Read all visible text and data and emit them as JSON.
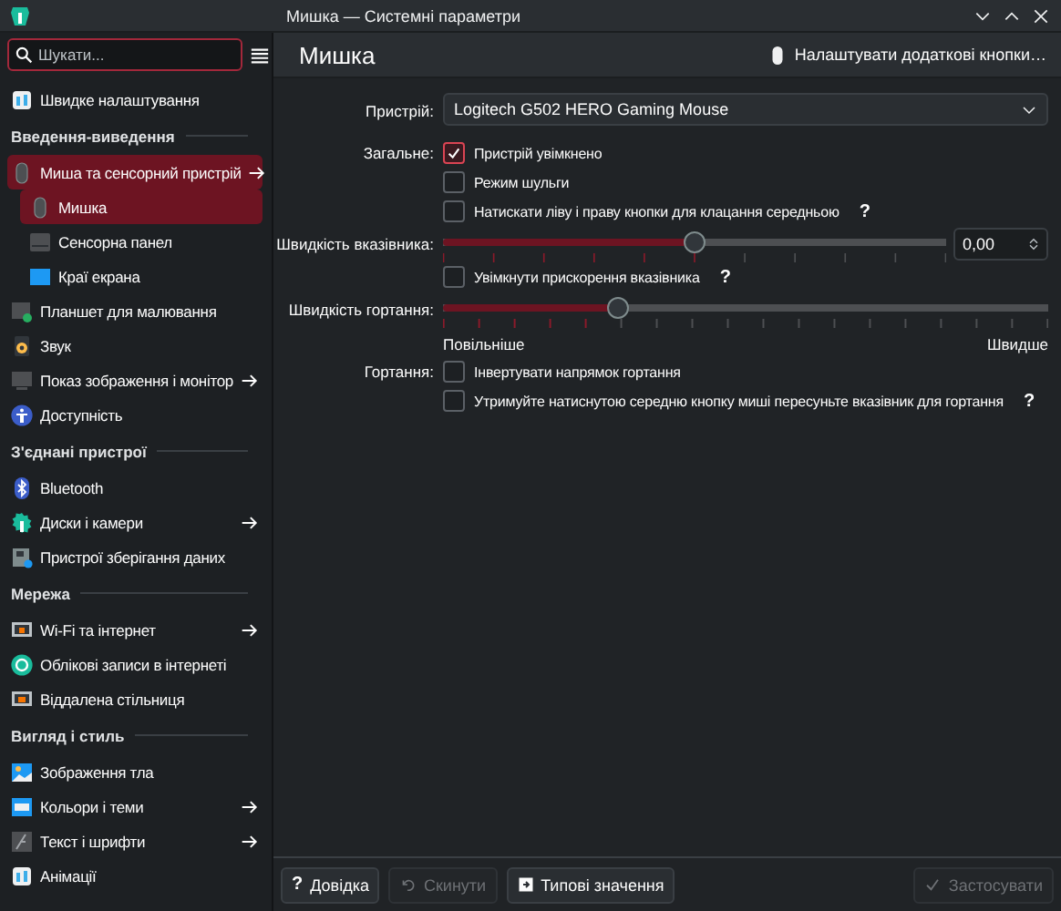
{
  "window": {
    "title": "Мишка — Системні параметри"
  },
  "sidebar": {
    "search": {
      "placeholder": "Шукати..."
    },
    "items": [
      {
        "kind": "item",
        "label": "Швидке налаштування",
        "selected": false,
        "submenu": false
      },
      {
        "kind": "heading",
        "label": "Введення-виведення"
      },
      {
        "kind": "item",
        "label": "Миша та сенсорний пристрій",
        "selected": true,
        "submenu": true,
        "children": [
          {
            "kind": "item",
            "label": "Мишка",
            "selected": true,
            "submenu": false
          },
          {
            "kind": "item",
            "label": "Сенсорна панел",
            "selected": false,
            "submenu": false
          },
          {
            "kind": "item",
            "label": "Краї екрана",
            "selected": false,
            "submenu": false
          }
        ]
      },
      {
        "kind": "item",
        "label": "Планшет для малювання",
        "selected": false,
        "submenu": false
      },
      {
        "kind": "item",
        "label": "Звук",
        "selected": false,
        "submenu": false
      },
      {
        "kind": "item",
        "label": "Показ зображення і монітор",
        "selected": false,
        "submenu": true
      },
      {
        "kind": "item",
        "label": "Доступність",
        "selected": false,
        "submenu": false
      },
      {
        "kind": "heading",
        "label": "З'єднані пристрої"
      },
      {
        "kind": "item",
        "label": "Bluetooth",
        "selected": false,
        "submenu": false
      },
      {
        "kind": "item",
        "label": "Диски і камери",
        "selected": false,
        "submenu": true
      },
      {
        "kind": "item",
        "label": "Пристрої зберігання даних",
        "selected": false,
        "submenu": false
      },
      {
        "kind": "heading",
        "label": "Мережа"
      },
      {
        "kind": "item",
        "label": "Wi-Fi та інтернет",
        "selected": false,
        "submenu": true
      },
      {
        "kind": "item",
        "label": "Облікові записи в інтернеті",
        "selected": false,
        "submenu": false
      },
      {
        "kind": "item",
        "label": "Віддалена стільниця",
        "selected": false,
        "submenu": false
      },
      {
        "kind": "heading",
        "label": "Вигляд і стиль"
      },
      {
        "kind": "item",
        "label": "Зображення тла",
        "selected": false,
        "submenu": false
      },
      {
        "kind": "item",
        "label": "Кольори і теми",
        "selected": false,
        "submenu": true
      },
      {
        "kind": "item",
        "label": "Текст і шрифти",
        "selected": false,
        "submenu": true
      },
      {
        "kind": "item",
        "label": "Анімації",
        "selected": false,
        "submenu": false
      }
    ]
  },
  "main": {
    "title": "Мишка",
    "header_button": "Налаштувати додаткові кнопки…",
    "rows": [
      {
        "kind": "select",
        "label": "Пристрій:",
        "value": "Logitech G502 HERO Gaming Mouse"
      },
      {
        "kind": "check",
        "label": "Загальне:",
        "text": "Пристрій увімкнено",
        "checked": true
      },
      {
        "kind": "check",
        "text": "Режим шульги",
        "checked": false
      },
      {
        "kind": "check",
        "text": "Натискати ліву і праву кнопки для клацання середньою",
        "checked": false,
        "help": "?"
      },
      {
        "kind": "slider",
        "label": "Швидкість вказівника:",
        "level": 0.5,
        "spin": "0,00"
      },
      {
        "kind": "check",
        "text": "Увімкнути прискорення вказівника",
        "checked": false,
        "help": "?"
      },
      {
        "kind": "slider",
        "label": "Швидкість гортання:",
        "level": 0.29
      },
      {
        "kind": "scale",
        "min": "Повільніше",
        "max": "Швидше"
      },
      {
        "kind": "check",
        "label": "Гортання:",
        "text": "Інвертувати напрямок гортання",
        "checked": false
      },
      {
        "kind": "check",
        "text": "Утримуйте натиснутою середню кнопку миші пересуньте вказівник для гортання",
        "checked": false,
        "help": "?"
      }
    ]
  },
  "footer": {
    "buttons": [
      {
        "kind": "help",
        "icon": "?",
        "label": "Довідка",
        "disabled": false
      },
      {
        "kind": "reset",
        "label": "Скинути",
        "disabled": true
      },
      {
        "kind": "defaults",
        "label": "Типові значення",
        "disabled": false
      },
      {
        "kind": "apply",
        "label": "Застосувати",
        "disabled": true
      }
    ]
  }
}
